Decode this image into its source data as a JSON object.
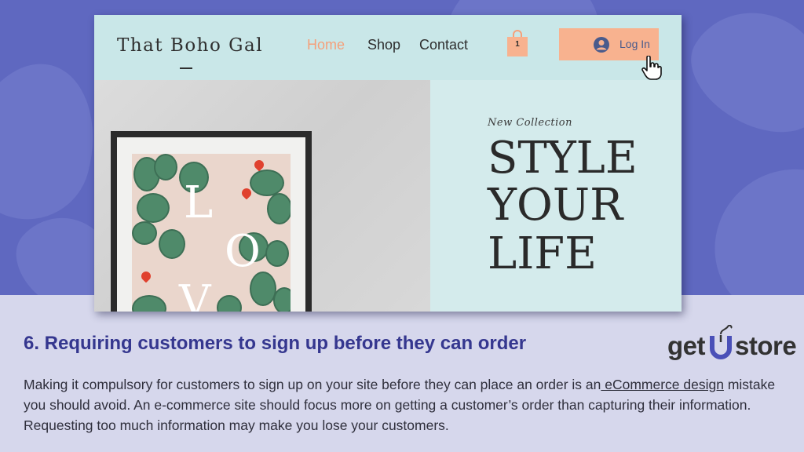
{
  "site": {
    "brand": "That Boho Gal",
    "nav": [
      "Home",
      "Shop",
      "Contact"
    ],
    "cart_count": "1",
    "login_label": "Log In",
    "hero": {
      "tagline": "New Collection",
      "headline": [
        "STYLE",
        "YOUR",
        "LIFE"
      ],
      "print_letters": [
        "L",
        "O",
        "V"
      ]
    }
  },
  "article": {
    "title": "6. Requiring customers to sign up before they can order",
    "body_before_link": "Making it compulsory for customers to sign up on your site before they can place an order is an",
    "link_text": " eCommerce design",
    "body_after_link": " mistake you should avoid. An e-commerce site should focus more on getting a customer’s order than capturing their information. Requesting too much information may make you lose your customers."
  },
  "logo": {
    "part1": "get",
    "part2": "store"
  },
  "colors": {
    "accent_orange": "#f8b28f",
    "nav_active": "#f5a07a",
    "title_blue": "#35378f",
    "logo_blue": "#4a50b8"
  }
}
